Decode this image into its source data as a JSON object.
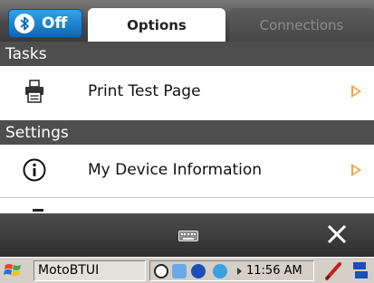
{
  "header": {
    "bluetooth_toggle": {
      "label": "Off",
      "icon": "bluetooth-icon",
      "color": "#0c66b5"
    },
    "tabs": [
      {
        "label": "Options",
        "active": true
      },
      {
        "label": "Connections",
        "active": false
      }
    ]
  },
  "sections": [
    {
      "title": "Tasks",
      "items": [
        {
          "label": "Print Test Page",
          "icon": "printer-icon",
          "has_arrow": true
        }
      ]
    },
    {
      "title": "Settings",
      "items": [
        {
          "label": "My Device Information",
          "icon": "info-icon",
          "has_arrow": true
        }
      ]
    }
  ],
  "softbar": {
    "keyboard_icon": "keyboard-icon",
    "close_icon": "close-icon"
  },
  "taskbar": {
    "start_icon": "windows-start-icon",
    "active_app": "MotoBTUI",
    "tray_icons": [
      "network-icon",
      "bluetooth-tray-icon",
      "motorola-icon",
      "connectivity-icon"
    ],
    "time": "11:56 AM",
    "pen_icon": "pen-input-icon",
    "input_panel_icon": "input-panel-icon"
  },
  "colors": {
    "accent_arrow": "#f3a33c",
    "section_header_bg": "#4e4e4e",
    "bluetooth_blue": "#0c66b5"
  }
}
